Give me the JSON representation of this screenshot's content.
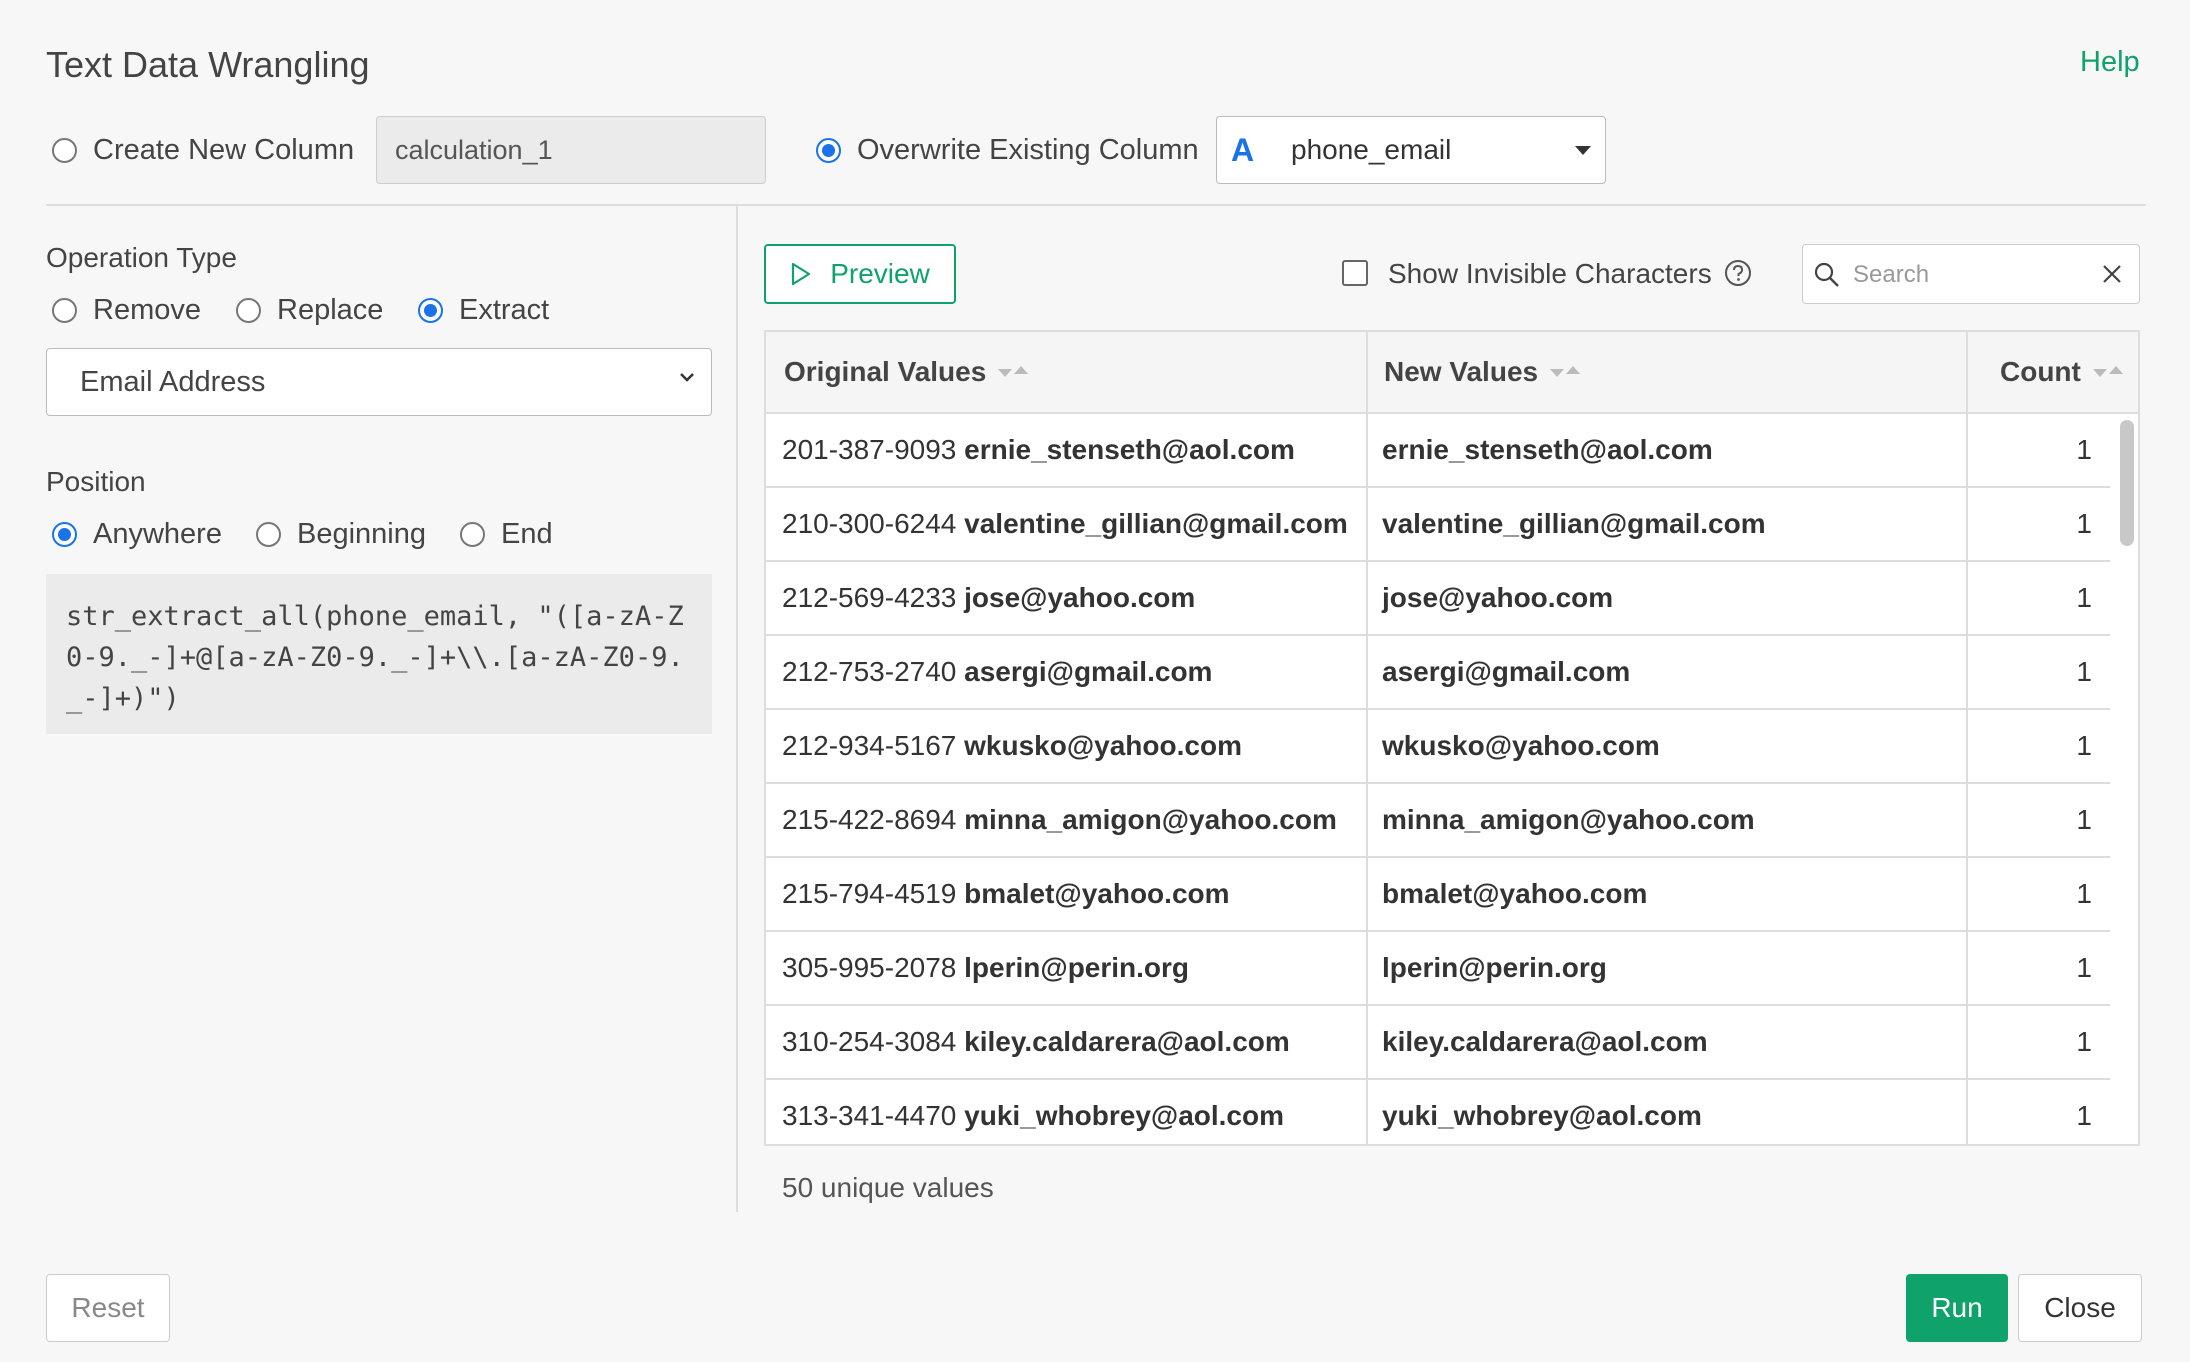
{
  "title": "Text Data Wrangling",
  "help_label": "Help",
  "target": {
    "create_new_label": "Create New Column",
    "new_column_value": "calculation_1",
    "overwrite_label": "Overwrite Existing Column",
    "column_type_icon": "A",
    "column_selected": "phone_email"
  },
  "operation": {
    "label": "Operation Type",
    "remove": "Remove",
    "replace": "Replace",
    "extract": "Extract",
    "selected": "Extract",
    "pattern_selected": "Email Address"
  },
  "position": {
    "label": "Position",
    "anywhere": "Anywhere",
    "beginning": "Beginning",
    "end": "End",
    "selected": "Anywhere"
  },
  "code": "str_extract_all(phone_email, \"([a-zA-Z0-9._-]+@[a-zA-Z0-9._-]+\\\\.[a-zA-Z0-9._-]+)\")",
  "preview_label": "Preview",
  "show_invisible_label": "Show Invisible Characters",
  "search_placeholder": "Search",
  "table": {
    "headers": [
      "Original Values",
      "New Values",
      "Count"
    ],
    "rows": [
      {
        "phone": "201-387-9093",
        "email": "ernie_stenseth@aol.com",
        "new": "ernie_stenseth@aol.com",
        "count": "1"
      },
      {
        "phone": "210-300-6244",
        "email": "valentine_gillian@gmail.com",
        "new": "valentine_gillian@gmail.com",
        "count": "1"
      },
      {
        "phone": "212-569-4233",
        "email": "jose@yahoo.com",
        "new": "jose@yahoo.com",
        "count": "1"
      },
      {
        "phone": "212-753-2740",
        "email": "asergi@gmail.com",
        "new": "asergi@gmail.com",
        "count": "1"
      },
      {
        "phone": "212-934-5167",
        "email": "wkusko@yahoo.com",
        "new": "wkusko@yahoo.com",
        "count": "1"
      },
      {
        "phone": "215-422-8694",
        "email": "minna_amigon@yahoo.com",
        "new": "minna_amigon@yahoo.com",
        "count": "1"
      },
      {
        "phone": "215-794-4519",
        "email": "bmalet@yahoo.com",
        "new": "bmalet@yahoo.com",
        "count": "1"
      },
      {
        "phone": "305-995-2078",
        "email": "lperin@perin.org",
        "new": "lperin@perin.org",
        "count": "1"
      },
      {
        "phone": "310-254-3084",
        "email": "kiley.caldarera@aol.com",
        "new": "kiley.caldarera@aol.com",
        "count": "1"
      },
      {
        "phone": "313-341-4470",
        "email": "yuki_whobrey@aol.com",
        "new": "yuki_whobrey@aol.com",
        "count": "1"
      }
    ],
    "unique_count_text": "50 unique values"
  },
  "buttons": {
    "reset": "Reset",
    "run": "Run",
    "close": "Close"
  },
  "colors": {
    "accent": "#0fa36b",
    "radio_selected": "#1a73e8"
  },
  "icons": {
    "preview": "play-outline-icon",
    "help": "question-circle-icon",
    "search": "search-icon",
    "clear": "close-icon",
    "dropdown": "caret-down-icon"
  }
}
